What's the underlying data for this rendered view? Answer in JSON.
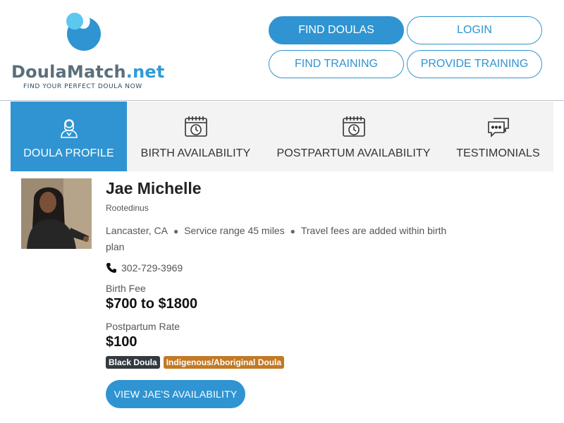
{
  "brand": {
    "name_main": "DoulaMatch",
    "name_suffix": ".net",
    "tagline": "FIND YOUR PERFECT DOULA NOW",
    "primary_color": "#2f94d1"
  },
  "nav": {
    "find_doulas": "FIND DOULAS",
    "login": "LOGIN",
    "find_training": "FIND TRAINING",
    "provide_training": "PROVIDE TRAINING"
  },
  "tabs": [
    {
      "label": "DOULA PROFILE",
      "icon": "doula-profile-icon",
      "active": true
    },
    {
      "label": "BIRTH AVAILABILITY",
      "icon": "calendar-clock-icon",
      "active": false
    },
    {
      "label": "POSTPARTUM AVAILABILITY",
      "icon": "calendar-clock-icon",
      "active": false
    },
    {
      "label": "TESTIMONIALS",
      "icon": "chat-bubbles-icon",
      "active": false
    }
  ],
  "profile": {
    "name": "Jae Michelle",
    "business": "Rootedinus",
    "location": "Lancaster, CA",
    "service_range": "Service range 45 miles",
    "travel_fees": "Travel fees are added within birth plan",
    "phone": "302-729-3969",
    "birth_fee_label": "Birth Fee",
    "birth_fee_value": "$700 to $1800",
    "postpartum_label": "Postpartum Rate",
    "postpartum_value": "$100",
    "badges": [
      {
        "label": "Black Doula",
        "color": "#333a40"
      },
      {
        "label": "Indigenous/Aboriginal Doula",
        "color": "#c27a26"
      }
    ],
    "cta_label": "VIEW JAE'S AVAILABILITY"
  }
}
